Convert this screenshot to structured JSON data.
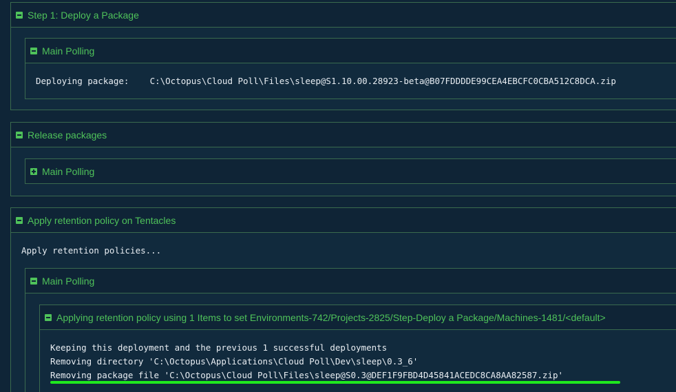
{
  "step1": {
    "title": "Step 1: Deploy a Package",
    "polling": {
      "title": "Main Polling",
      "log": "Deploying package:    C:\\Octopus\\Cloud Poll\\Files\\sleep@S1.10.00.28923-beta@B07FDDDDE99CEA4EBCFC0CBA512C8DCA.zip"
    }
  },
  "release": {
    "title": "Release packages",
    "polling": {
      "title": "Main Polling"
    }
  },
  "retention": {
    "title": "Apply retention policy on Tentacles",
    "log": "Apply retention policies...",
    "polling": {
      "title": "Main Polling",
      "policy": {
        "title": "Applying retention policy using 1 Items to set Environments-742/Projects-2825/Step-Deploy a Package/Machines-1481/<default>",
        "lines": [
          "Keeping this deployment and the previous 1 successful deployments",
          "Removing directory 'C:\\Octopus\\Applications\\Cloud Poll\\Dev\\sleep\\0.3_6'",
          "Removing package file 'C:\\Octopus\\Cloud Poll\\Files\\sleep@S0.3@DEF1F9FBD4D45841ACEDC8CA8AA82587.zip'"
        ]
      }
    }
  },
  "colors": {
    "accent": "#4fc25a",
    "highlight": "#1ee81e",
    "background": "#0f2537"
  }
}
